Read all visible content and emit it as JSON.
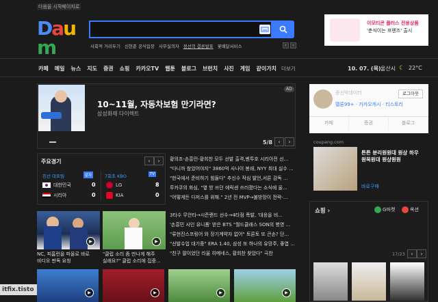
{
  "header": {
    "startpage_label": "다음을 시작페이지로",
    "logo_text": "Daum",
    "search_placeholder": "",
    "hot_links": [
      "사회적 거리두기",
      "신현준 공식입장",
      "사무실의자",
      "정선의 결론발표",
      "꽃배달서비스"
    ],
    "ad_line1": "이모티콘 플러스 전용상품",
    "ad_line2": "'춘식이는 프렌즈' 출시"
  },
  "gnb": {
    "items": [
      "카페",
      "메일",
      "뉴스",
      "지도",
      "증권",
      "쇼핑",
      "카카오TV",
      "웹툰",
      "블로그",
      "브런치",
      "사진",
      "게임",
      "같이가치"
    ],
    "more": "더보기",
    "date": "10. 07. (목)",
    "region": "울산시",
    "temperature": "22°C"
  },
  "banner": {
    "title": "10~11월, 자동차보험 만기라면?",
    "subtitle": "삼성화재 다이렉트",
    "ad_badge": "AD",
    "page": "5/8",
    "prev": "‹",
    "next": "›"
  },
  "sports": {
    "title": "주요경기",
    "game1_label": "친선  대표팀",
    "game1_badge": "문자",
    "game2_label": "7회초  KBO",
    "game2_badge": "TV",
    "teams": [
      {
        "name": "대한민국",
        "score": "0"
      },
      {
        "name": "시리아",
        "score": "0"
      },
      {
        "name": "LG",
        "score": "8"
      },
      {
        "name": "KIA",
        "score": "0"
      }
    ]
  },
  "news_top": [
    "황의조-손흥민-황희찬 모두 선발 출격,벤투호 시리아전 선...",
    "\"다니까 참았어야지\" 3860억 사나이 봉쇄, NYY 최대 실수 ...",
    "\"한국에서 준비하기 힘들다\" 추신수 작심 발언,서른 감독 ...",
    "루카쿠의 화심, \"옆 방 쓰던 에릭센 쓰러졌다는 소식에 울...",
    "\"어떻게든 다저스를 위해.\" 2년 전 MVP→불방망이 전락-..."
  ],
  "news_bottom": [
    "3타수 무안타→시즌랜드 선수→4타점 폭발, '대응을 비...",
    "'손흥민 사인 유니폼' 받은 BTS \"월드클래스 SON의 병영 ...",
    "\"류현진스프링어 와 장기계약자 없어\" 토론토 또 큰손? 단...",
    "\"선발수업 대기중\" ERA 1.40, 삼성 또 하나의 유망주, 좋엽 ...",
    "\"친구 팔이었던 라울 히메네스, 황희찬 찾았다\" 극찬"
  ],
  "thumbs": [
    {
      "caption1": "NC, 피홈런을 파울로 바로",
      "caption2": "비디오 판독 요청"
    },
    {
      "caption1": "\"클럽 소리 좀 만나게 해주",
      "caption2": "실래요?\" 클럽 소리에 집중..."
    }
  ],
  "right": {
    "username": "종신박데이터",
    "level": "멜론99+ · 카카오캐시 · 티스토리",
    "login_button": "로그아웃",
    "profile_tabs": [
      "카페",
      "증권",
      "블로그"
    ],
    "coupang_label": "coupang.com",
    "coupang_title": "튼튼 분리원원대 원상 하우 원목원대 원상원원",
    "coupang_cta": "바로구매",
    "shopping_title": "쇼핑 ›",
    "gmarket": "G마켓",
    "auction": "옥션",
    "shop_page": "17/23"
  },
  "watermark": "itfix.tisto"
}
